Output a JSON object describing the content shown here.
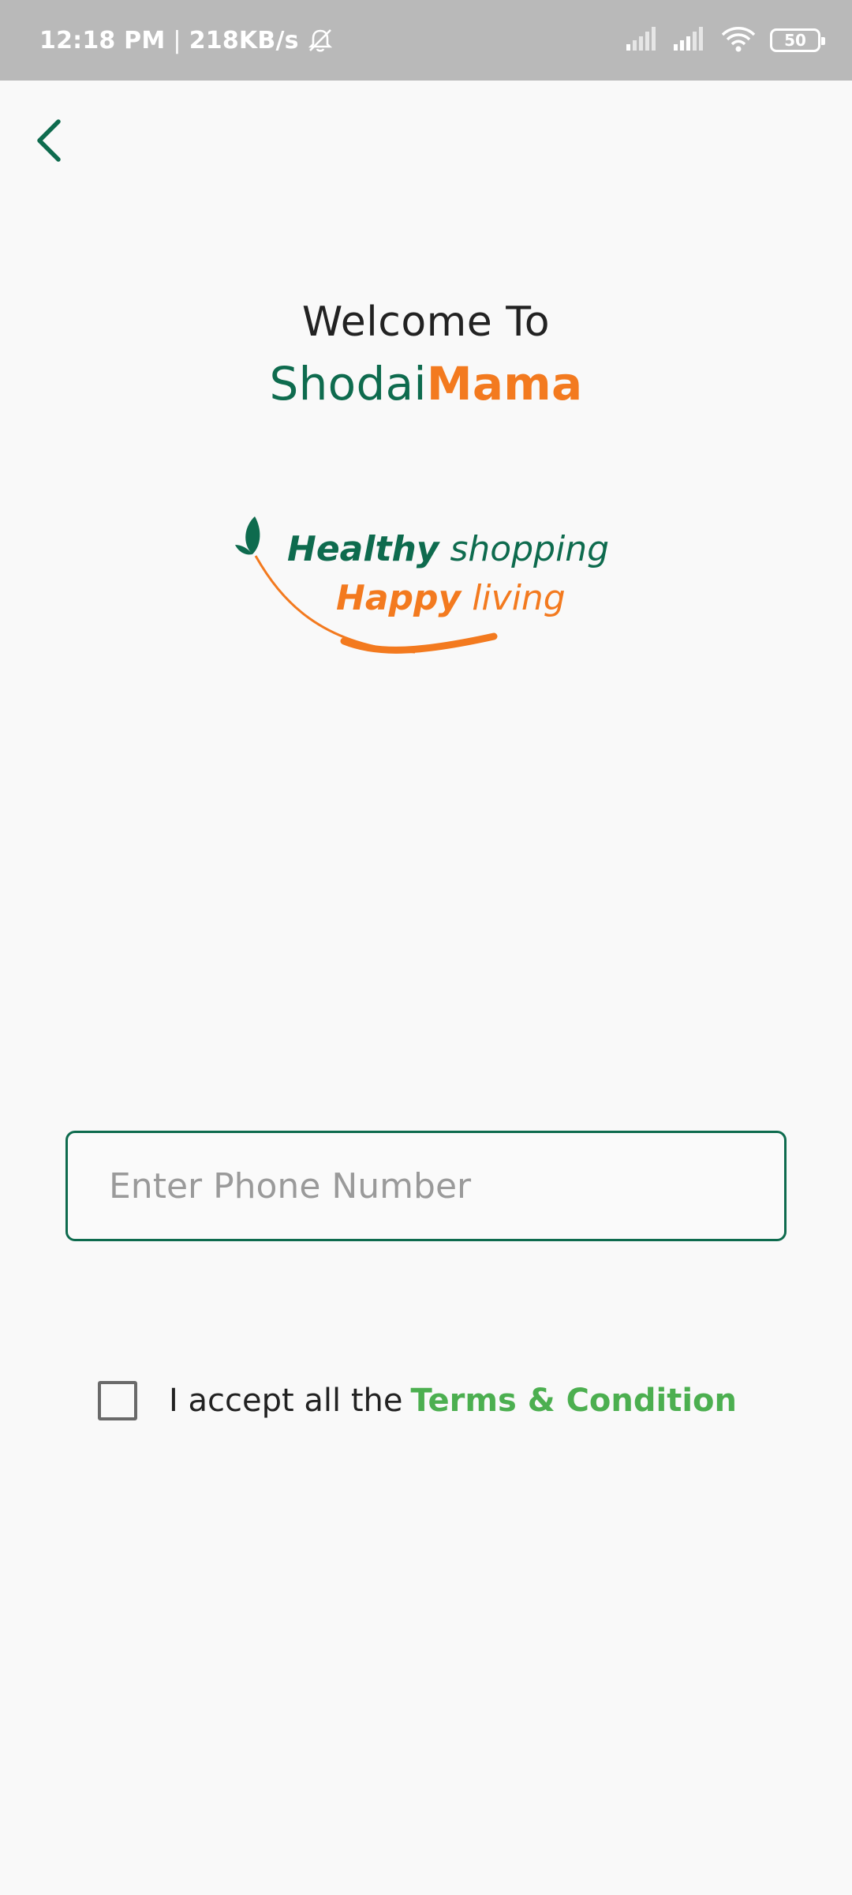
{
  "status_bar": {
    "time": "12:18 PM",
    "separator": "|",
    "network_speed": "218KB/s",
    "battery_level": "50",
    "icons": [
      "bell-off-icon",
      "signal-icon",
      "signal-icon",
      "wifi-icon",
      "battery-icon"
    ]
  },
  "header": {
    "back_icon": "chevron-left-icon",
    "welcome": "Welcome To",
    "brand_part1": "Shodai",
    "brand_part2": "Mama"
  },
  "logo": {
    "line1_bold": "Healthy",
    "line1_light": "shopping",
    "line2_bold": "Happy",
    "line2_light": "living",
    "icon": "leaf-icon"
  },
  "form": {
    "phone_placeholder": "Enter Phone Number",
    "phone_value": "",
    "accept_text": "I accept all the",
    "terms_link": "Terms & Condition",
    "accept_checked": false
  },
  "colors": {
    "primary_green": "#0e6b4e",
    "accent_orange": "#f37a1f",
    "link_green": "#4caf50",
    "status_bar_bg": "#b9b9b9"
  }
}
